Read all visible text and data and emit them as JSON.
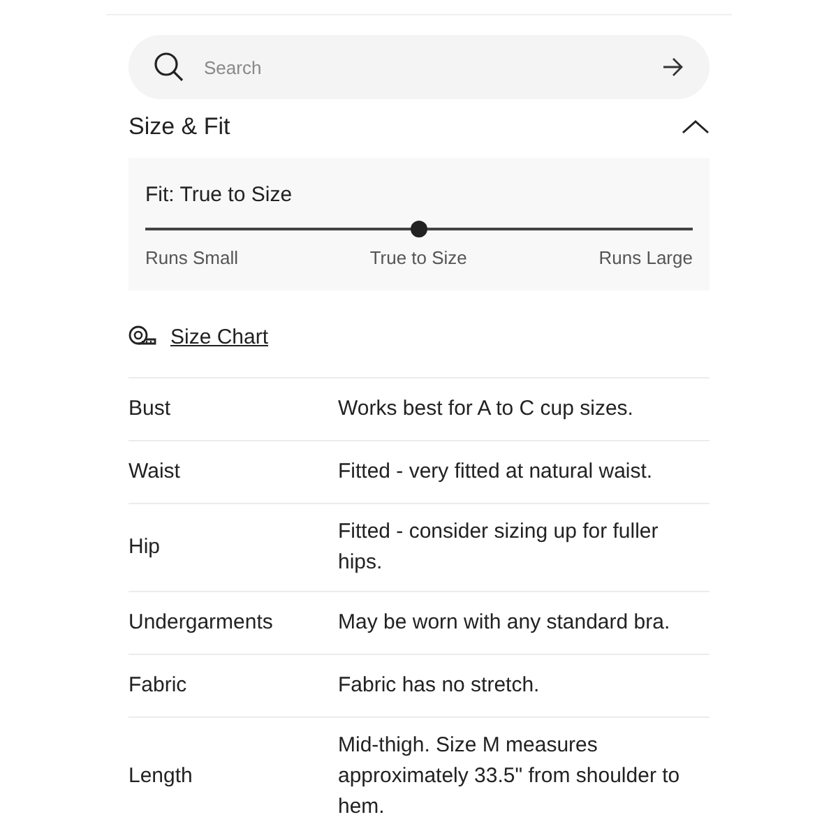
{
  "search": {
    "placeholder": "Search"
  },
  "section": {
    "title": "Size & Fit",
    "expanded": true
  },
  "fit": {
    "label": "Fit: True to Size",
    "level": 0.5,
    "scale_labels": [
      "Runs Small",
      "True to Size",
      "Runs Large"
    ]
  },
  "size_chart_link": "Size Chart",
  "details": [
    {
      "label": "Bust",
      "value": "Works best for A to C cup sizes."
    },
    {
      "label": "Waist",
      "value": "Fitted - very fitted at natural waist."
    },
    {
      "label": "Hip",
      "value": "Fitted - consider sizing up for fuller hips."
    },
    {
      "label": "Undergarments",
      "value": "May be worn with any standard bra."
    },
    {
      "label": "Fabric",
      "value": "Fabric has no stretch."
    },
    {
      "label": "Length",
      "value": "Mid-thigh. Size M measures approximately 33.5\" from shoulder to hem."
    }
  ]
}
